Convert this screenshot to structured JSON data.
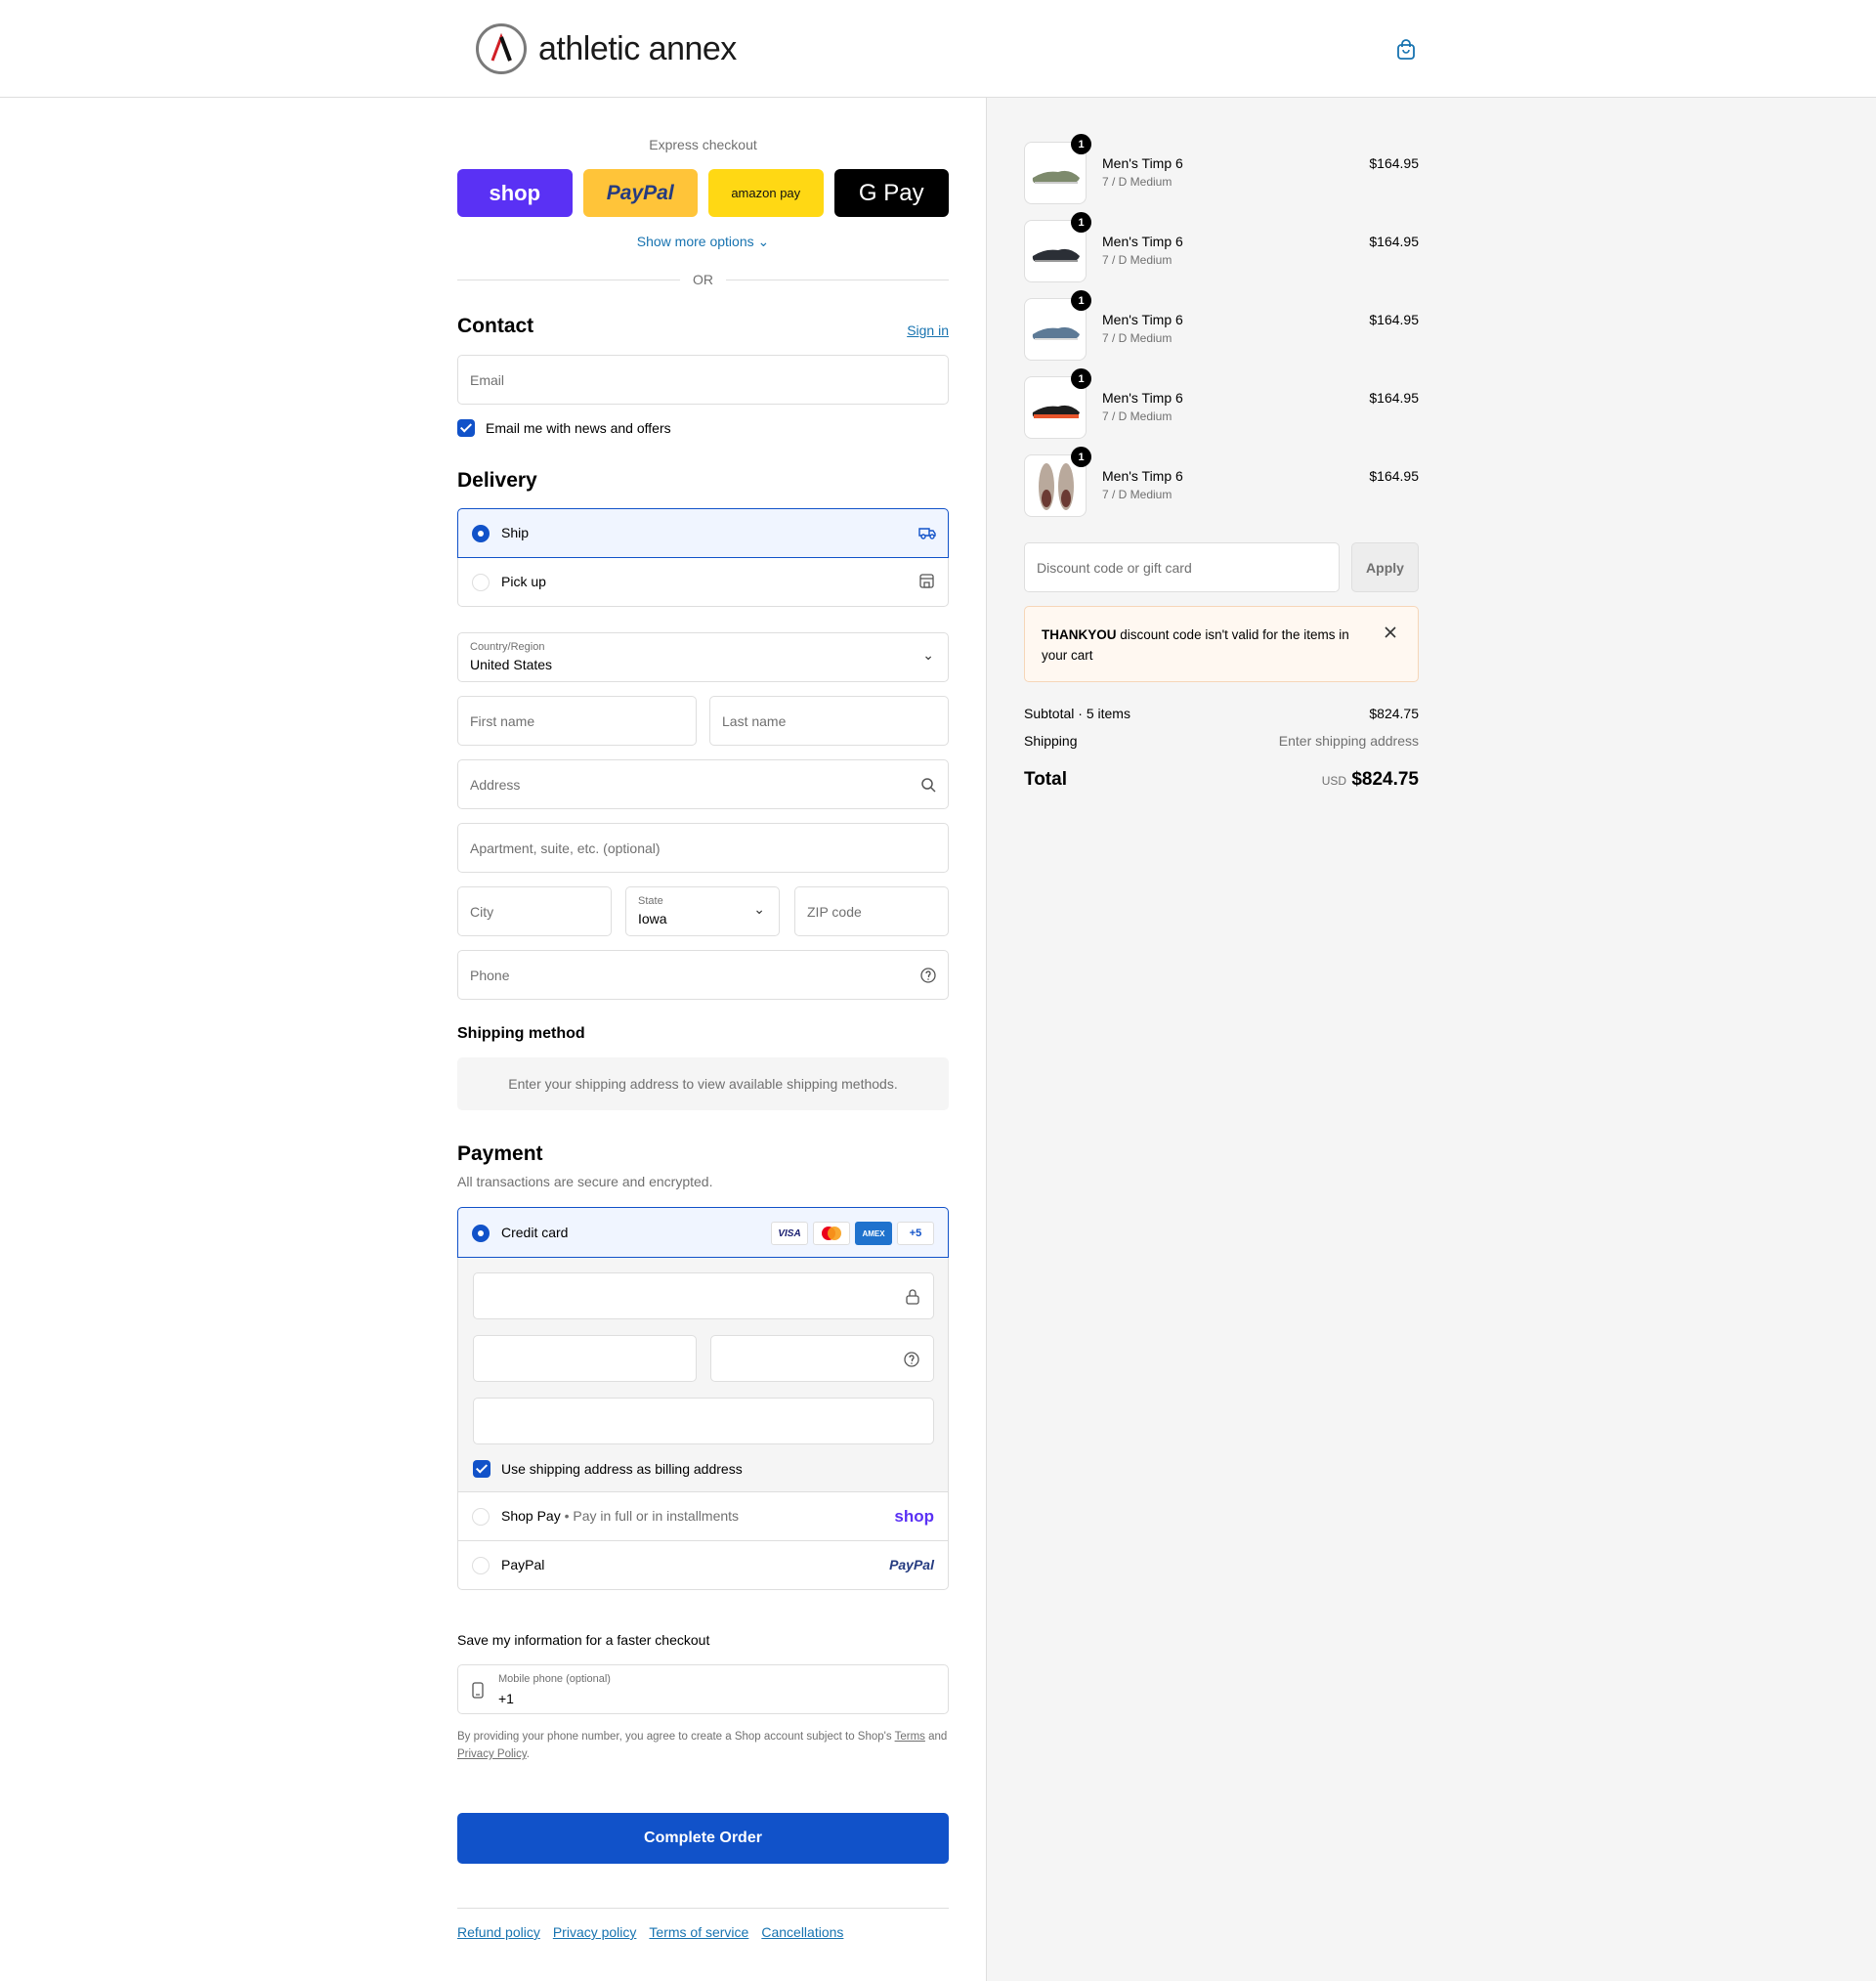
{
  "header": {
    "brand": "athletic annex"
  },
  "express": {
    "title": "Express checkout",
    "shop_label": "shop",
    "paypal_label": "PayPal",
    "amazon_label": "amazon pay",
    "gpay_label": "G Pay",
    "more_options": "Show more options",
    "or": "OR"
  },
  "contact": {
    "title": "Contact",
    "sign_in": "Sign in",
    "email_placeholder": "Email",
    "news_label": "Email me with news and offers"
  },
  "delivery": {
    "title": "Delivery",
    "ship_label": "Ship",
    "pickup_label": "Pick up",
    "country_label": "Country/Region",
    "country_value": "United States",
    "first_name_placeholder": "First name",
    "last_name_placeholder": "Last name",
    "address_placeholder": "Address",
    "apartment_placeholder": "Apartment, suite, etc. (optional)",
    "city_placeholder": "City",
    "state_label": "State",
    "state_value": "Iowa",
    "zip_placeholder": "ZIP code",
    "phone_placeholder": "Phone"
  },
  "shipping_method": {
    "title": "Shipping method",
    "notice": "Enter your shipping address to view available shipping methods."
  },
  "payment": {
    "title": "Payment",
    "subtitle": "All transactions are secure and encrypted.",
    "credit_card_label": "Credit card",
    "card_brands": [
      "VISA",
      "",
      "AMEX",
      "+5"
    ],
    "billing_label": "Use shipping address as billing address",
    "shop_pay_label": "Shop Pay",
    "shop_pay_sub": "Pay in full or in installments",
    "shop_pay_logo": "shop",
    "paypal_label": "PayPal",
    "paypal_logo": "PayPal"
  },
  "save_info": {
    "title": "Save my information for a faster checkout",
    "mobile_label": "Mobile phone (optional)",
    "mobile_value": "+1",
    "legal_prefix": "By providing your phone number, you agree to create a Shop account subject to Shop's",
    "terms": "Terms",
    "and": "and",
    "privacy": "Privacy Policy",
    "period": "."
  },
  "complete_button": "Complete Order",
  "footer_links": [
    "Refund policy",
    "Privacy policy",
    "Terms of service",
    "Cancellations"
  ],
  "order": {
    "items": [
      {
        "qty": "1",
        "name": "Men's Timp 6",
        "variant": "7 / D Medium",
        "price": "$164.95",
        "color": "#7d8a6c"
      },
      {
        "qty": "1",
        "name": "Men's Timp 6",
        "variant": "7 / D Medium",
        "price": "$164.95",
        "color": "#2b2f36"
      },
      {
        "qty": "1",
        "name": "Men's Timp 6",
        "variant": "7 / D Medium",
        "price": "$164.95",
        "color": "#5d7a96"
      },
      {
        "qty": "1",
        "name": "Men's Timp 6",
        "variant": "7 / D Medium",
        "price": "$164.95",
        "color": "#e8552c"
      },
      {
        "qty": "1",
        "name": "Men's Timp 6",
        "variant": "7 / D Medium",
        "price": "$164.95",
        "color": "#b9a99c"
      }
    ],
    "discount_placeholder": "Discount code or gift card",
    "apply": "Apply",
    "banner_code": "THANKYOU",
    "banner_text": "discount code isn't valid for the items in your cart",
    "subtotal_label": "Subtotal · 5 items",
    "subtotal_value": "$824.75",
    "shipping_label": "Shipping",
    "shipping_value": "Enter shipping address",
    "total_label": "Total",
    "total_currency": "USD",
    "total_value": "$824.75"
  },
  "colors": {
    "accent": "#1152c9",
    "link": "#1773b0",
    "shop": "#5a31f4",
    "paypal": "#ffc439",
    "amazon": "#ffd814"
  }
}
